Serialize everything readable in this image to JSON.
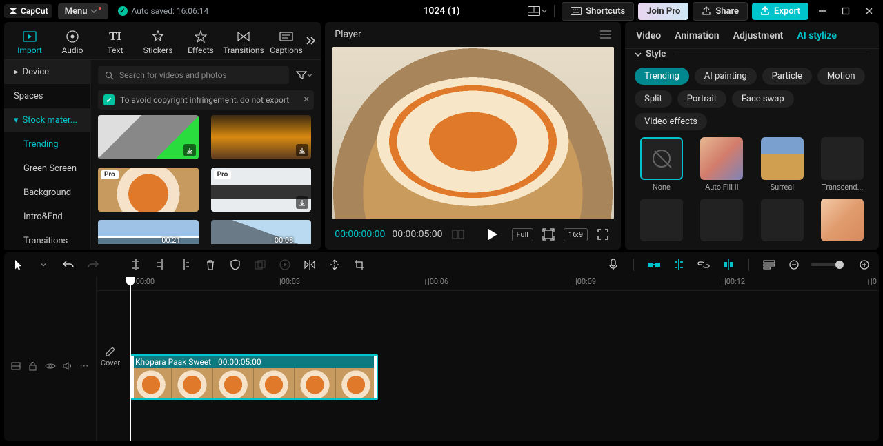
{
  "titlebar": {
    "app": "CapCut",
    "menu": "Menu",
    "autosave": "Auto saved: 16:06:14",
    "project": "1024 (1)",
    "shortcuts": "Shortcuts",
    "join": "Join Pro",
    "share": "Share",
    "export": "Export"
  },
  "lib": {
    "tabs": [
      "Import",
      "Audio",
      "Text",
      "Stickers",
      "Effects",
      "Transitions",
      "Captions"
    ],
    "active_tab": 0,
    "side": {
      "device": "Device",
      "spaces": "Spaces",
      "stock": "Stock mater...",
      "trending": "Trending",
      "green": "Green Screen",
      "background": "Background",
      "introend": "Intro&End",
      "transitions": "Transitions"
    },
    "search_placeholder": "Search for videos and photos",
    "notice": "To avoid copyright infringement, do not export",
    "thumbs": [
      {
        "badge": "",
        "dur": ""
      },
      {
        "badge": "",
        "dur": ""
      },
      {
        "badge": "Pro",
        "dur": ""
      },
      {
        "badge": "Pro",
        "dur": ""
      },
      {
        "badge": "",
        "dur": "00:21"
      },
      {
        "badge": "",
        "dur": "00:08"
      }
    ]
  },
  "player": {
    "title": "Player",
    "tc_current": "00:00:00:00",
    "tc_duration": "00:00:05:00",
    "full": "Full",
    "ratio_label": "16:9"
  },
  "inspector": {
    "tabs": [
      "Video",
      "Animation",
      "Adjustment",
      "AI stylize"
    ],
    "active": 3,
    "style_label": "Style",
    "chips": [
      "Trending",
      "AI painting",
      "Particle",
      "Motion",
      "Split",
      "Portrait",
      "Face swap",
      "Video effects"
    ],
    "active_chip": 0,
    "fx": [
      "None",
      "Auto Fill II",
      "Surreal",
      "Transcend...",
      "",
      "",
      "",
      ""
    ]
  },
  "timeline": {
    "ticks": [
      "00:00",
      "00:03",
      "00:06",
      "00:09",
      "00:12",
      "0"
    ],
    "cover": "Cover",
    "clip_name": "Khopara Paak Sweet",
    "clip_dur": "00:00:05:00"
  }
}
